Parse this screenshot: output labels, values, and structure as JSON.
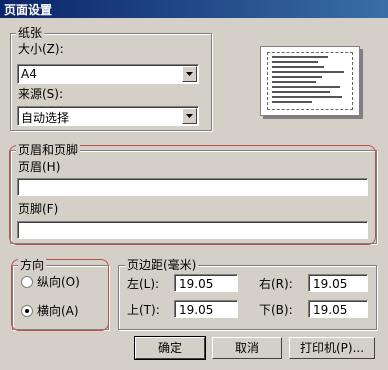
{
  "window": {
    "title": "页面设置"
  },
  "paper": {
    "group_label": "纸张",
    "size_label": "大小(Z):",
    "size_value": "A4",
    "source_label": "来源(S):",
    "source_value": "自动选择"
  },
  "header_footer": {
    "group_label": "页眉和页脚",
    "header_label": "页眉(H)",
    "header_value": "",
    "footer_label": "页脚(F)",
    "footer_value": ""
  },
  "orientation": {
    "group_label": "方向",
    "portrait_label": "纵向(O)",
    "landscape_label": "横向(A)",
    "selected": "landscape"
  },
  "margins": {
    "group_label": "页边距(毫米)",
    "left_label": "左(L):",
    "left_value": "19.05",
    "right_label": "右(R):",
    "right_value": "19.05",
    "top_label": "上(T):",
    "top_value": "19.05",
    "bottom_label": "下(B):",
    "bottom_value": "19.05"
  },
  "buttons": {
    "ok": "确定",
    "cancel": "取消",
    "printer": "打印机(P)..."
  },
  "colors": {
    "title_start": "#0a246a",
    "title_end": "#3a6ea5",
    "annotation": "#c0504d"
  }
}
